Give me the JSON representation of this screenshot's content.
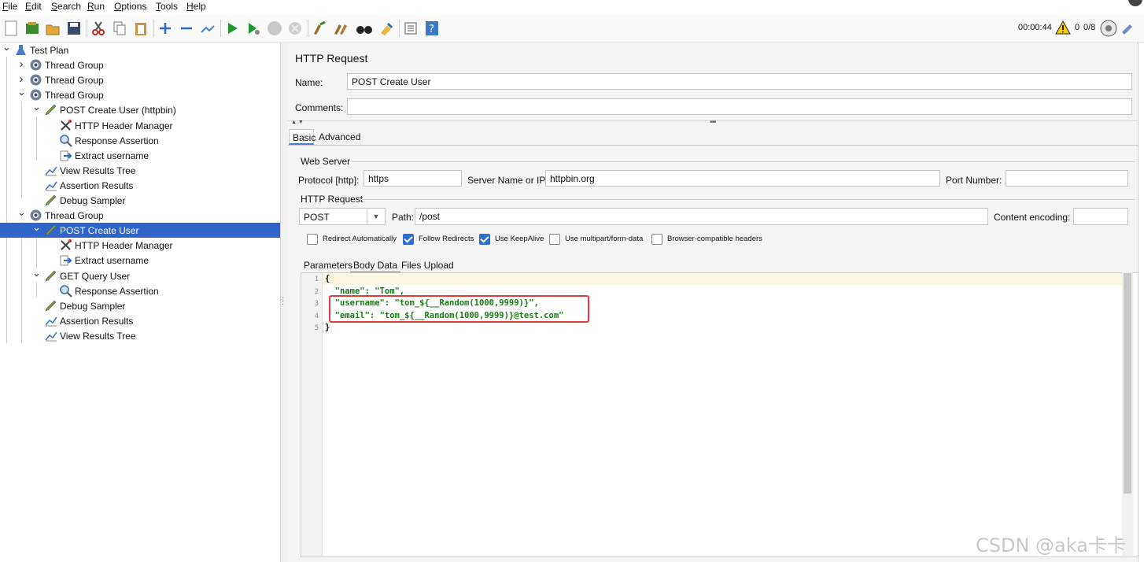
{
  "menu": [
    "File",
    "Edit",
    "Search",
    "Run",
    "Options",
    "Tools",
    "Help"
  ],
  "status": {
    "elapsed": "00:00:44",
    "warnings": "0",
    "threads": "0/8"
  },
  "tree": [
    {
      "label": "Test Plan",
      "icon": "test-plan-icon",
      "toggle": "v"
    },
    {
      "label": "Thread Group",
      "icon": "gear-icon",
      "toggle": ">"
    },
    {
      "label": "Thread Group",
      "icon": "gear-icon",
      "toggle": ">"
    },
    {
      "label": "Thread Group",
      "icon": "gear-icon",
      "toggle": "v"
    },
    {
      "label": "POST Create User (httpbin)",
      "icon": "sampler-pen-icon",
      "toggle": "v"
    },
    {
      "label": "HTTP Header Manager",
      "icon": "wrench-icon",
      "toggle": ""
    },
    {
      "label": "Response Assertion",
      "icon": "magnifier-icon",
      "toggle": ""
    },
    {
      "label": "Extract username",
      "icon": "extractor-arrow-icon",
      "toggle": ""
    },
    {
      "label": "View Results Tree",
      "icon": "chart-icon",
      "toggle": ""
    },
    {
      "label": "Assertion Results",
      "icon": "chart-icon",
      "toggle": ""
    },
    {
      "label": "Debug Sampler",
      "icon": "sampler-pen-icon",
      "toggle": ""
    },
    {
      "label": "Thread Group",
      "icon": "gear-icon",
      "toggle": "v"
    },
    {
      "label": "POST Create User",
      "icon": "sampler-pen-icon",
      "toggle": "v"
    },
    {
      "label": "HTTP Header Manager",
      "icon": "wrench-icon",
      "toggle": ""
    },
    {
      "label": "Extract username",
      "icon": "extractor-arrow-icon",
      "toggle": ""
    },
    {
      "label": "GET Query User",
      "icon": "sampler-pen-icon",
      "toggle": "v"
    },
    {
      "label": "Response Assertion",
      "icon": "magnifier-icon",
      "toggle": ""
    },
    {
      "label": "Debug Sampler",
      "icon": "sampler-pen-icon",
      "toggle": ""
    },
    {
      "label": "Assertion Results",
      "icon": "chart-icon",
      "toggle": ""
    },
    {
      "label": "View Results Tree",
      "icon": "chart-icon",
      "toggle": ""
    }
  ],
  "panel": {
    "title": "HTTP Request",
    "name_label": "Name:",
    "name_value": "POST Create User",
    "comments_label": "Comments:",
    "comments_value": "",
    "tabs": [
      "Basic",
      "Advanced"
    ],
    "web_server_title": "Web Server",
    "protocol_label": "Protocol [http]:",
    "protocol_value": "https",
    "server_label": "Server Name or IP:",
    "server_value": "httpbin.org",
    "port_label": "Port Number:",
    "port_value": "",
    "http_request_title": "HTTP Request",
    "method": "POST",
    "path_label": "Path:",
    "path_value": "/post",
    "encoding_label": "Content encoding:",
    "encoding_value": "",
    "checkboxes": [
      {
        "label": "Redirect Automatically",
        "checked": false
      },
      {
        "label": "Follow Redirects",
        "checked": true
      },
      {
        "label": "Use KeepAlive",
        "checked": true
      },
      {
        "label": "Use multipart/form-data",
        "checked": false
      },
      {
        "label": "Browser-compatible headers",
        "checked": false
      }
    ],
    "subtabs": [
      "Parameters",
      "Body Data",
      "Files Upload"
    ],
    "line_numbers": [
      "1",
      "2",
      "3",
      "4",
      "5"
    ],
    "body_lines": [
      {
        "key": "",
        "rest": "{"
      },
      {
        "key": "\"name\"",
        "rest": ": \"Tom\","
      },
      {
        "key": "\"username\"",
        "rest": ": \"tom_${__Random(1000,9999)}\","
      },
      {
        "key": "\"email\"",
        "rest": ": \"tom_${__Random(1000,9999)}@test.com\""
      },
      {
        "key": "",
        "rest": "}"
      }
    ]
  },
  "watermark": "CSDN @aka卡卡"
}
